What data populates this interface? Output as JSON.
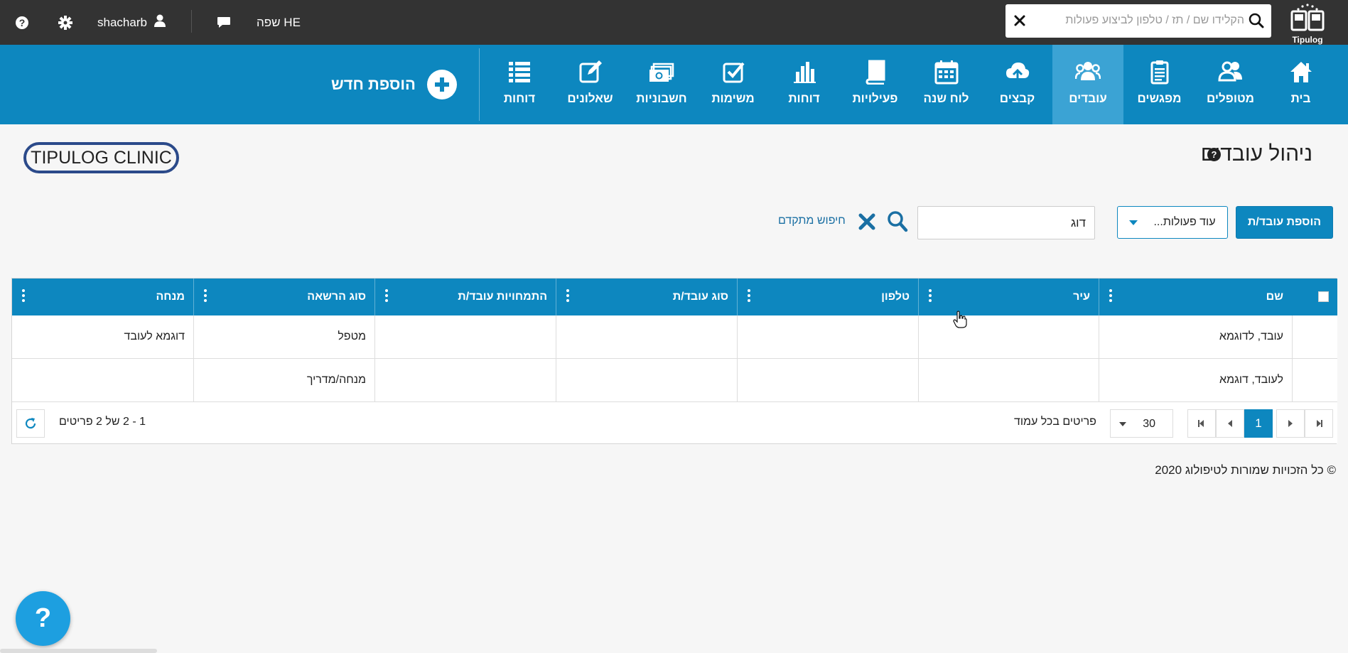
{
  "topbar": {
    "help_icon": "question-circle-icon",
    "settings_icon": "gear-icon",
    "username": "shacharb",
    "user_icon": "user-icon",
    "chat_icon": "chat-bubble-icon",
    "language_label": "שפה HE",
    "search_placeholder": "הקלידו שם / תז / טלפון לביצוע פעולות",
    "logo_text": "Tipulog"
  },
  "nav": {
    "items": [
      {
        "label": "בית",
        "icon": "home-icon"
      },
      {
        "label": "מטופלים",
        "icon": "patients-icon"
      },
      {
        "label": "מפגשים",
        "icon": "clipboard-icon"
      },
      {
        "label": "עובדים",
        "icon": "employees-icon",
        "active": true
      },
      {
        "label": "קבצים",
        "icon": "cloud-upload-icon"
      },
      {
        "label": "לוח שנה",
        "icon": "calendar-icon"
      },
      {
        "label": "פעילויות",
        "icon": "book-icon"
      },
      {
        "label": "דוחות",
        "icon": "bar-chart-icon"
      },
      {
        "label": "משימות",
        "icon": "task-check-icon"
      },
      {
        "label": "חשבוניות",
        "icon": "money-icon"
      },
      {
        "label": "שאלונים",
        "icon": "edit-icon"
      },
      {
        "label": "דוחות",
        "icon": "list-icon"
      }
    ],
    "add_new_label": "הוספת חדש"
  },
  "page": {
    "title": "ניהול עובדים",
    "help_mark": "?",
    "clinic_logo_text": "TIPULOG CLINIC"
  },
  "toolbar": {
    "add_employee_label": "הוספת עובד/ת",
    "more_actions_label": "עוד פעולות...",
    "filter_value": "דוג",
    "advanced_search_label": "חיפוש מתקדם"
  },
  "grid": {
    "columns": [
      "שם",
      "עיר",
      "טלפון",
      "סוג עובד/ת",
      "התמחויות עובד/ת",
      "סוג הרשאה",
      "מנחה"
    ],
    "rows": [
      [
        "עובד, לדוגמא",
        "",
        "",
        "",
        "",
        "מטפל",
        "דוגמא לעובד"
      ],
      [
        "לעובד, דוגמא",
        "",
        "",
        "",
        "",
        "מנחה/מדריך",
        ""
      ]
    ]
  },
  "pager": {
    "current_page": "1",
    "page_size": "30",
    "page_size_label": "פריטים בכל עמוד",
    "info": "1 - 2 של 2 פריטים"
  },
  "footer": {
    "copyright": "© כל הזכויות שמורות לטיפולוג 2020"
  },
  "help_fab": "?",
  "colors": {
    "topbar": "#333333",
    "brand_blue": "#0d87bf",
    "active_tab": "#3ba3d4"
  }
}
